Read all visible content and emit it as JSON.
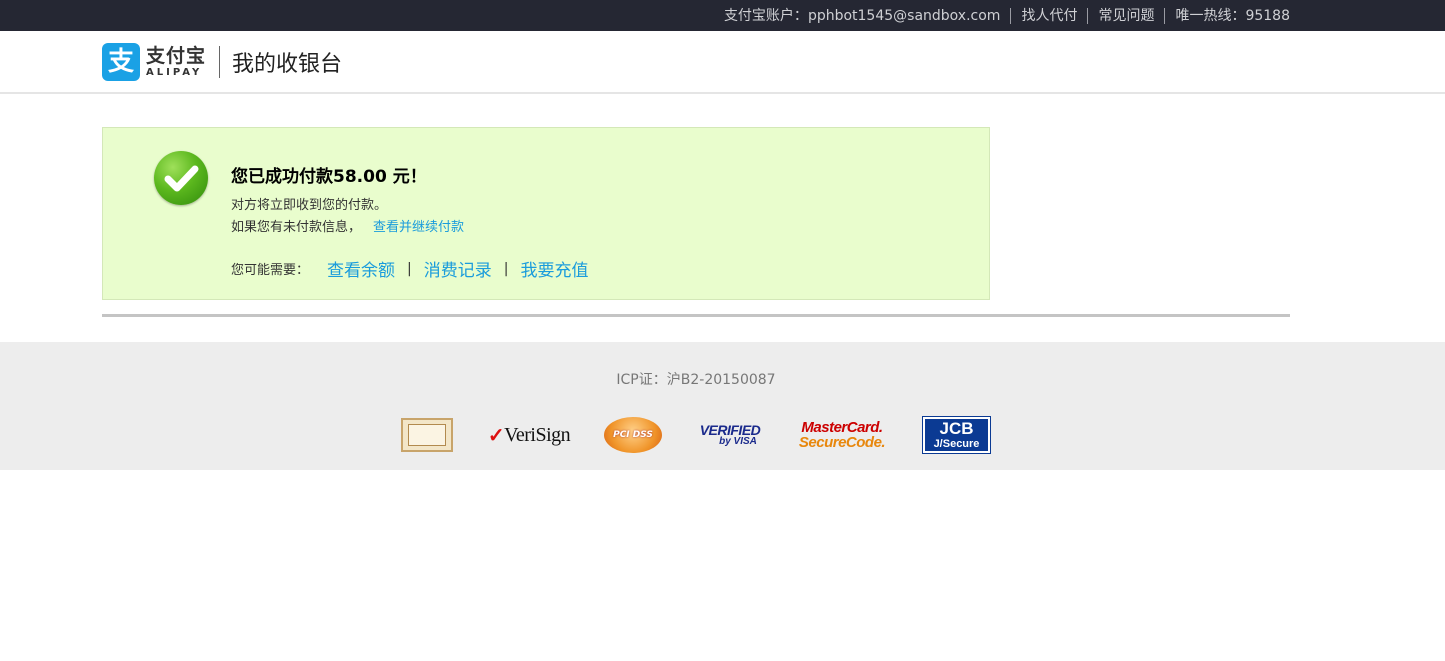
{
  "topbar": {
    "account_label": "支付宝账户：",
    "account_email": "pphbot1545@sandbox.com",
    "links": [
      "找人代付",
      "常见问题"
    ],
    "hotline_label": "唯一热线：",
    "hotline_number": "95188"
  },
  "header": {
    "logo_icon": "支",
    "logo_cn": "支付宝",
    "logo_en": "ALIPAY",
    "page_title": "我的收银台"
  },
  "success": {
    "icon": "success-check-icon",
    "title": "您已成功付款58.00 元！",
    "line1": "对方将立即收到您的付款。",
    "line2_text": "如果您有未付款信息，",
    "line2_link": "查看并继续付款",
    "need_label": "您可能需要：",
    "need_links": [
      "查看余额",
      "消费记录",
      "我要充值"
    ],
    "separator": "|"
  },
  "footer": {
    "icp": "ICP证：沪B2-20150087",
    "badges": {
      "verisign": "VeriSign",
      "pci": "PCI DSS",
      "visa_line1": "VERIFIED",
      "visa_line2": "by VISA",
      "mastercard_line1": "MasterCard.",
      "mastercard_line2": "SecureCode.",
      "jcb_line1": "JCB",
      "jcb_line2": "J/Secure"
    }
  },
  "colors": {
    "topbar_bg": "#252733",
    "brand_blue": "#1aa1e5",
    "link_blue": "#1a9cdc",
    "success_bg": "#e9fdcd",
    "footer_bg": "#ededed"
  }
}
